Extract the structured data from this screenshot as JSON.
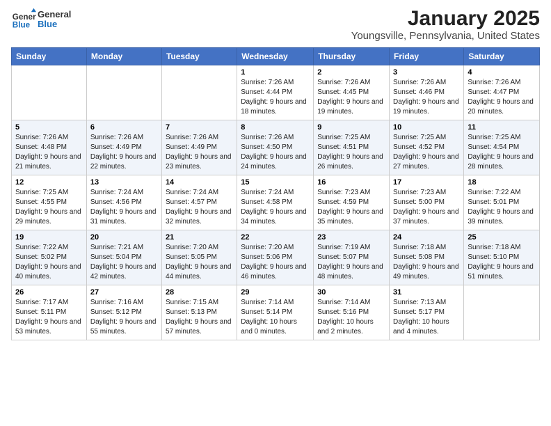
{
  "header": {
    "logo": {
      "general": "General",
      "blue": "Blue"
    },
    "title": "January 2025",
    "subtitle": "Youngsville, Pennsylvania, United States"
  },
  "calendar": {
    "days_of_week": [
      "Sunday",
      "Monday",
      "Tuesday",
      "Wednesday",
      "Thursday",
      "Friday",
      "Saturday"
    ],
    "weeks": [
      [
        {
          "day": "",
          "info": ""
        },
        {
          "day": "",
          "info": ""
        },
        {
          "day": "",
          "info": ""
        },
        {
          "day": "1",
          "info": "Sunrise: 7:26 AM\nSunset: 4:44 PM\nDaylight: 9 hours\nand 18 minutes."
        },
        {
          "day": "2",
          "info": "Sunrise: 7:26 AM\nSunset: 4:45 PM\nDaylight: 9 hours\nand 19 minutes."
        },
        {
          "day": "3",
          "info": "Sunrise: 7:26 AM\nSunset: 4:46 PM\nDaylight: 9 hours\nand 19 minutes."
        },
        {
          "day": "4",
          "info": "Sunrise: 7:26 AM\nSunset: 4:47 PM\nDaylight: 9 hours\nand 20 minutes."
        }
      ],
      [
        {
          "day": "5",
          "info": "Sunrise: 7:26 AM\nSunset: 4:48 PM\nDaylight: 9 hours\nand 21 minutes."
        },
        {
          "day": "6",
          "info": "Sunrise: 7:26 AM\nSunset: 4:49 PM\nDaylight: 9 hours\nand 22 minutes."
        },
        {
          "day": "7",
          "info": "Sunrise: 7:26 AM\nSunset: 4:49 PM\nDaylight: 9 hours\nand 23 minutes."
        },
        {
          "day": "8",
          "info": "Sunrise: 7:26 AM\nSunset: 4:50 PM\nDaylight: 9 hours\nand 24 minutes."
        },
        {
          "day": "9",
          "info": "Sunrise: 7:25 AM\nSunset: 4:51 PM\nDaylight: 9 hours\nand 26 minutes."
        },
        {
          "day": "10",
          "info": "Sunrise: 7:25 AM\nSunset: 4:52 PM\nDaylight: 9 hours\nand 27 minutes."
        },
        {
          "day": "11",
          "info": "Sunrise: 7:25 AM\nSunset: 4:54 PM\nDaylight: 9 hours\nand 28 minutes."
        }
      ],
      [
        {
          "day": "12",
          "info": "Sunrise: 7:25 AM\nSunset: 4:55 PM\nDaylight: 9 hours\nand 29 minutes."
        },
        {
          "day": "13",
          "info": "Sunrise: 7:24 AM\nSunset: 4:56 PM\nDaylight: 9 hours\nand 31 minutes."
        },
        {
          "day": "14",
          "info": "Sunrise: 7:24 AM\nSunset: 4:57 PM\nDaylight: 9 hours\nand 32 minutes."
        },
        {
          "day": "15",
          "info": "Sunrise: 7:24 AM\nSunset: 4:58 PM\nDaylight: 9 hours\nand 34 minutes."
        },
        {
          "day": "16",
          "info": "Sunrise: 7:23 AM\nSunset: 4:59 PM\nDaylight: 9 hours\nand 35 minutes."
        },
        {
          "day": "17",
          "info": "Sunrise: 7:23 AM\nSunset: 5:00 PM\nDaylight: 9 hours\nand 37 minutes."
        },
        {
          "day": "18",
          "info": "Sunrise: 7:22 AM\nSunset: 5:01 PM\nDaylight: 9 hours\nand 39 minutes."
        }
      ],
      [
        {
          "day": "19",
          "info": "Sunrise: 7:22 AM\nSunset: 5:02 PM\nDaylight: 9 hours\nand 40 minutes."
        },
        {
          "day": "20",
          "info": "Sunrise: 7:21 AM\nSunset: 5:04 PM\nDaylight: 9 hours\nand 42 minutes."
        },
        {
          "day": "21",
          "info": "Sunrise: 7:20 AM\nSunset: 5:05 PM\nDaylight: 9 hours\nand 44 minutes."
        },
        {
          "day": "22",
          "info": "Sunrise: 7:20 AM\nSunset: 5:06 PM\nDaylight: 9 hours\nand 46 minutes."
        },
        {
          "day": "23",
          "info": "Sunrise: 7:19 AM\nSunset: 5:07 PM\nDaylight: 9 hours\nand 48 minutes."
        },
        {
          "day": "24",
          "info": "Sunrise: 7:18 AM\nSunset: 5:08 PM\nDaylight: 9 hours\nand 49 minutes."
        },
        {
          "day": "25",
          "info": "Sunrise: 7:18 AM\nSunset: 5:10 PM\nDaylight: 9 hours\nand 51 minutes."
        }
      ],
      [
        {
          "day": "26",
          "info": "Sunrise: 7:17 AM\nSunset: 5:11 PM\nDaylight: 9 hours\nand 53 minutes."
        },
        {
          "day": "27",
          "info": "Sunrise: 7:16 AM\nSunset: 5:12 PM\nDaylight: 9 hours\nand 55 minutes."
        },
        {
          "day": "28",
          "info": "Sunrise: 7:15 AM\nSunset: 5:13 PM\nDaylight: 9 hours\nand 57 minutes."
        },
        {
          "day": "29",
          "info": "Sunrise: 7:14 AM\nSunset: 5:14 PM\nDaylight: 10 hours\nand 0 minutes."
        },
        {
          "day": "30",
          "info": "Sunrise: 7:14 AM\nSunset: 5:16 PM\nDaylight: 10 hours\nand 2 minutes."
        },
        {
          "day": "31",
          "info": "Sunrise: 7:13 AM\nSunset: 5:17 PM\nDaylight: 10 hours\nand 4 minutes."
        },
        {
          "day": "",
          "info": ""
        }
      ]
    ]
  }
}
